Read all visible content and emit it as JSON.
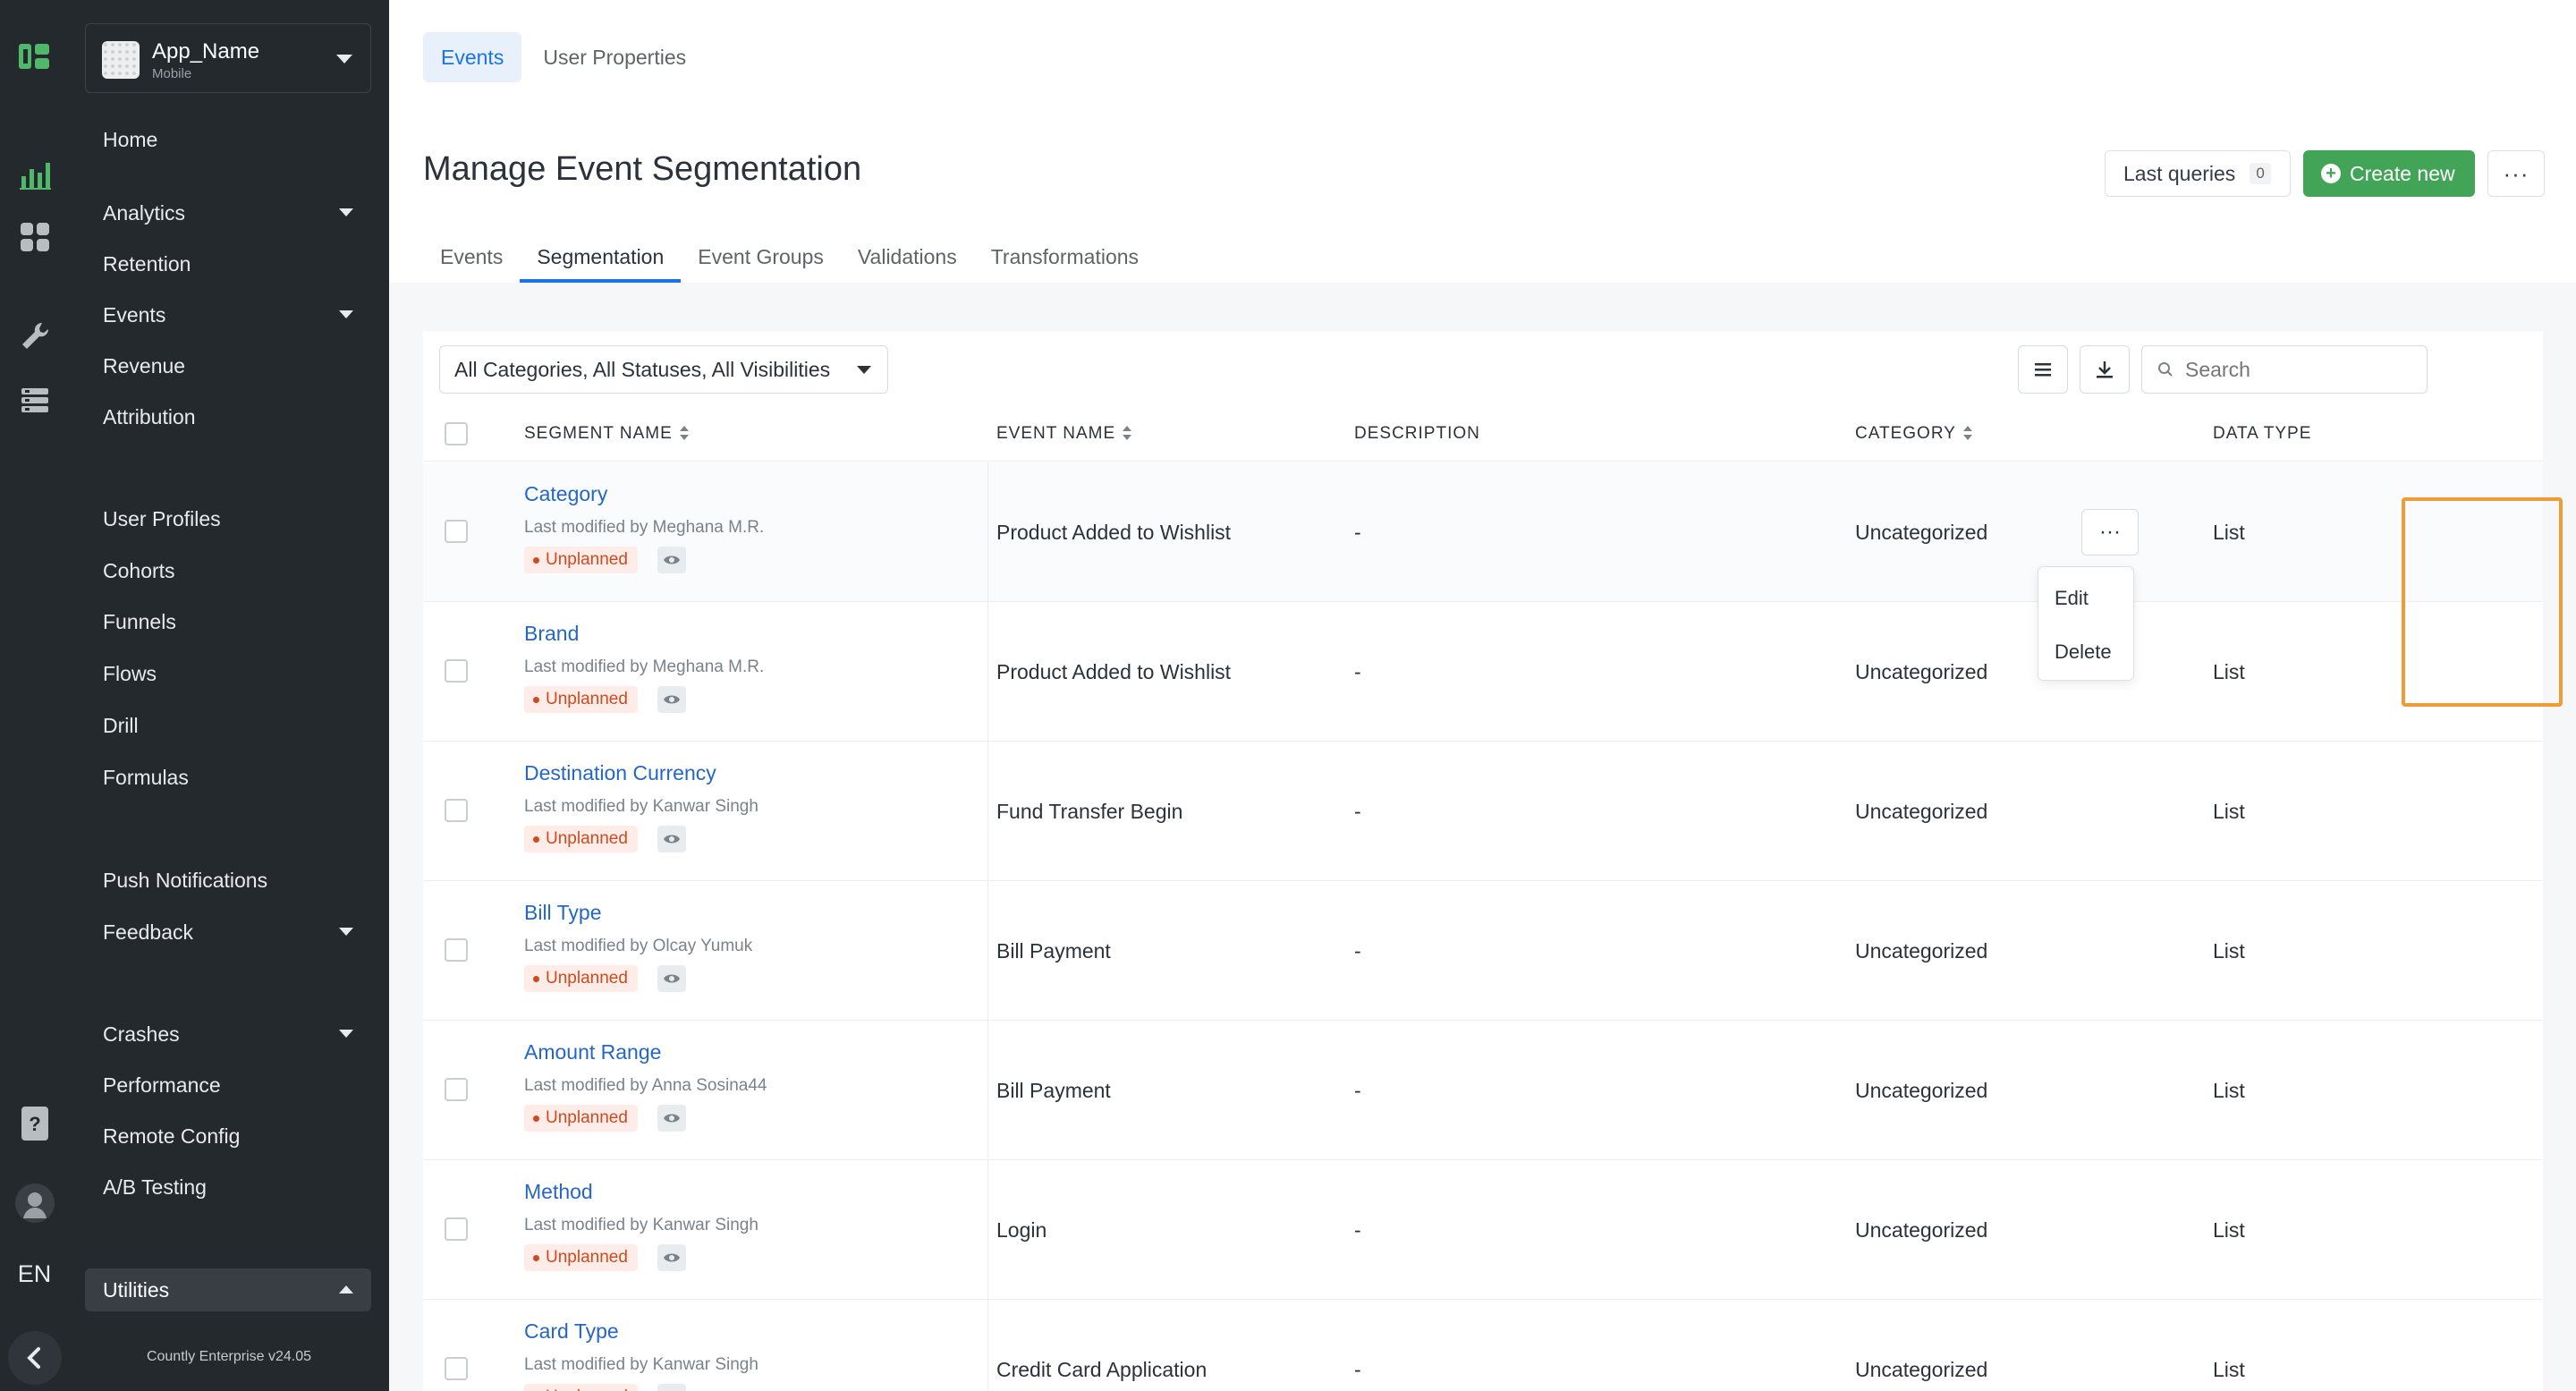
{
  "app": {
    "name": "App_Name",
    "platform": "Mobile",
    "version_label": "Countly Enterprise v24.05",
    "language": "EN"
  },
  "sidebar": {
    "items": [
      {
        "label": "Home",
        "caret": ""
      },
      {
        "label": "Analytics",
        "caret": "down"
      },
      {
        "label": "Retention",
        "caret": ""
      },
      {
        "label": "Events",
        "caret": "down"
      },
      {
        "label": "Revenue",
        "caret": ""
      },
      {
        "label": "Attribution",
        "caret": ""
      },
      {
        "label": "User Profiles",
        "caret": ""
      },
      {
        "label": "Cohorts",
        "caret": ""
      },
      {
        "label": "Funnels",
        "caret": ""
      },
      {
        "label": "Flows",
        "caret": ""
      },
      {
        "label": "Drill",
        "caret": ""
      },
      {
        "label": "Formulas",
        "caret": ""
      },
      {
        "label": "Push Notifications",
        "caret": ""
      },
      {
        "label": "Feedback",
        "caret": "down"
      },
      {
        "label": "Crashes",
        "caret": "down"
      },
      {
        "label": "Performance",
        "caret": ""
      },
      {
        "label": "Remote Config",
        "caret": ""
      },
      {
        "label": "A/B Testing",
        "caret": ""
      },
      {
        "label": "Utilities",
        "caret": "up"
      }
    ]
  },
  "topnav": {
    "tabs": [
      "Events",
      "User Properties"
    ],
    "active": "Events"
  },
  "header": {
    "title": "Manage Event Segmentation",
    "last_queries_label": "Last queries",
    "last_queries_count": "0",
    "create_label": "Create new",
    "more_label": "···"
  },
  "subtabs": {
    "items": [
      "Events",
      "Segmentation",
      "Event Groups",
      "Validations",
      "Transformations"
    ],
    "active": "Segmentation"
  },
  "toolbar": {
    "filter_label": "All Categories, All Statuses, All Visibilities",
    "search_placeholder": "Search"
  },
  "table": {
    "columns": [
      "Segment Name",
      "Event Name",
      "Description",
      "Category",
      "Data Type"
    ],
    "rows": [
      {
        "segment": "Category",
        "modified": "Last modified by Meghana M.R.",
        "status": "Unplanned",
        "event": "Product Added to Wishlist",
        "description": "-",
        "category": "Uncategorized",
        "data_type": "List"
      },
      {
        "segment": "Brand",
        "modified": "Last modified by Meghana M.R.",
        "status": "Unplanned",
        "event": "Product Added to Wishlist",
        "description": "-",
        "category": "Uncategorized",
        "data_type": "List"
      },
      {
        "segment": "Destination Currency",
        "modified": "Last modified by Kanwar Singh",
        "status": "Unplanned",
        "event": "Fund Transfer Begin",
        "description": "-",
        "category": "Uncategorized",
        "data_type": "List"
      },
      {
        "segment": "Bill Type",
        "modified": "Last modified by Olcay Yumuk",
        "status": "Unplanned",
        "event": "Bill Payment",
        "description": "-",
        "category": "Uncategorized",
        "data_type": "List"
      },
      {
        "segment": "Amount Range",
        "modified": "Last modified by Anna Sosina44",
        "status": "Unplanned",
        "event": "Bill Payment",
        "description": "-",
        "category": "Uncategorized",
        "data_type": "List"
      },
      {
        "segment": "Method",
        "modified": "Last modified by Kanwar Singh",
        "status": "Unplanned",
        "event": "Login",
        "description": "-",
        "category": "Uncategorized",
        "data_type": "List"
      },
      {
        "segment": "Card Type",
        "modified": "Last modified by Kanwar Singh",
        "status": "Unplanned",
        "event": "Credit Card Application",
        "description": "-",
        "category": "Uncategorized",
        "data_type": "List"
      }
    ]
  },
  "row_menu": {
    "trigger_label": "···",
    "items": [
      "Edit",
      "Delete"
    ]
  },
  "colors": {
    "accent_blue": "#1a73e8",
    "create_green": "#41a457",
    "badge_orange": "#d04a1f",
    "highlight_orange": "#f19a38",
    "sidebar_dark": "#24292e"
  }
}
